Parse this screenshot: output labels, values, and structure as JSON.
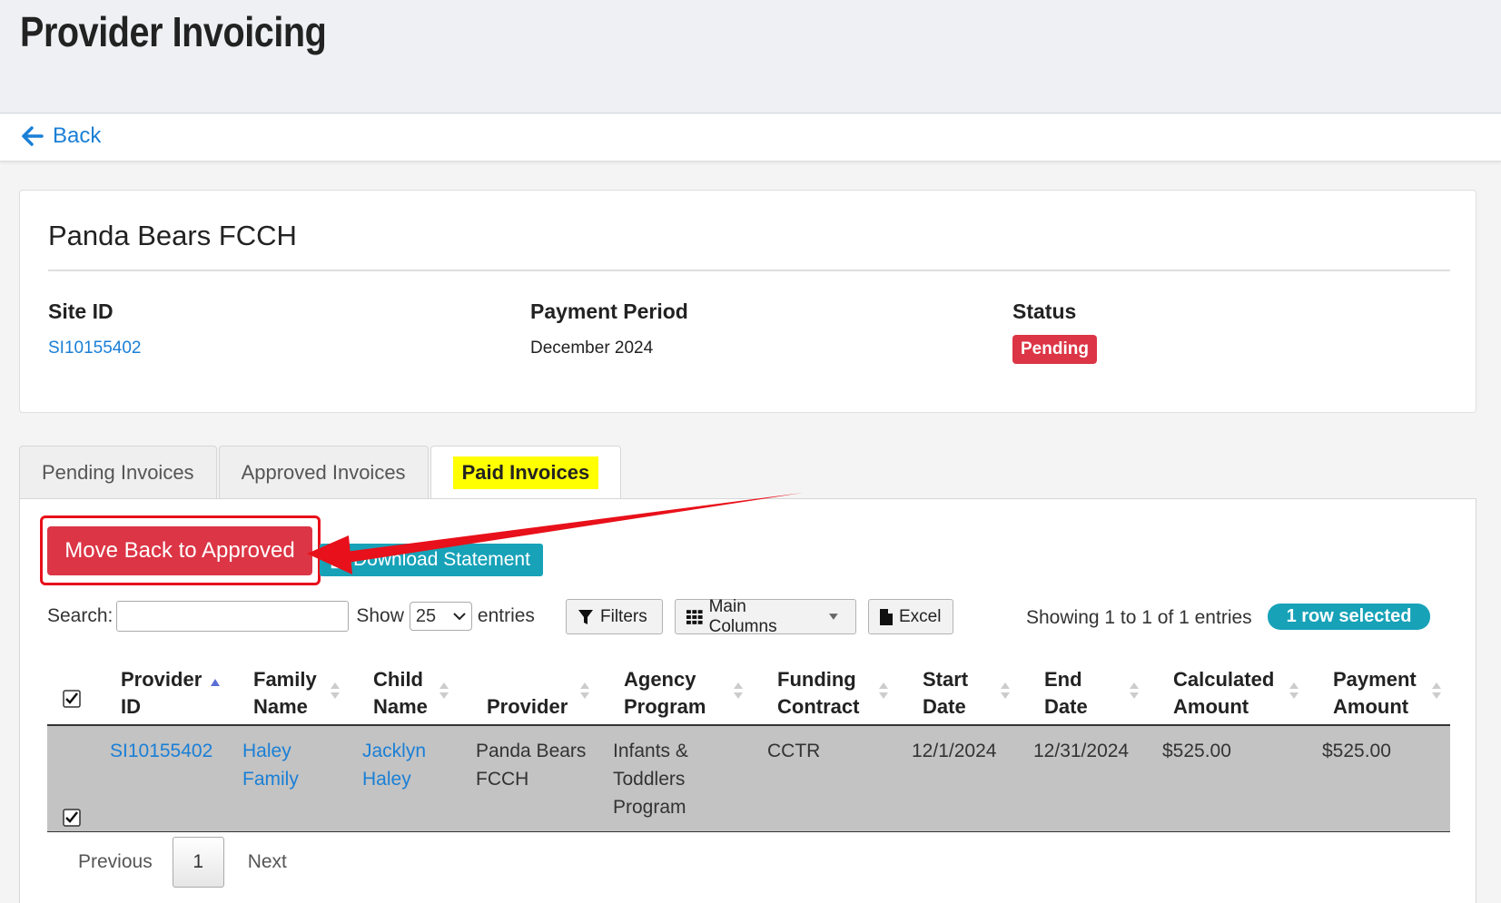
{
  "header": {
    "title": "Provider Invoicing"
  },
  "nav": {
    "back_label": "Back"
  },
  "provider": {
    "name": "Panda Bears FCCH",
    "site_id_label": "Site ID",
    "site_id_value": "SI10155402",
    "period_label": "Payment Period",
    "period_value": "December 2024",
    "status_label": "Status",
    "status_value": "Pending",
    "status_color": "#dc3545"
  },
  "tabs": [
    {
      "label": "Pending Invoices",
      "active": false
    },
    {
      "label": "Approved Invoices",
      "active": false
    },
    {
      "label": "Paid Invoices",
      "active": true
    }
  ],
  "actions": {
    "move_back_label": "Move Back to Approved",
    "download_label": "Download Statement"
  },
  "table_controls": {
    "search_label": "Search:",
    "show_label": "Show",
    "page_size": "25",
    "entries_label": "entries",
    "filters_label": "Filters",
    "columns_label": "Main Columns",
    "excel_label": "Excel",
    "showing_text": "Showing 1 to 1 of 1 entries",
    "selected_badge": "1 row selected"
  },
  "columns": [
    {
      "line1": "Provider",
      "line2": "ID"
    },
    {
      "line1": "Family",
      "line2": "Name"
    },
    {
      "line1": "Child",
      "line2": "Name"
    },
    {
      "line1": "",
      "line2": "Provider"
    },
    {
      "line1": "Agency",
      "line2": "Program"
    },
    {
      "line1": "Funding",
      "line2": "Contract"
    },
    {
      "line1": "Start",
      "line2": "Date"
    },
    {
      "line1": "End",
      "line2": "Date"
    },
    {
      "line1": "Calculated",
      "line2": "Amount"
    },
    {
      "line1": "Payment",
      "line2": "Amount"
    }
  ],
  "rows": [
    {
      "selected": true,
      "provider_id": "SI10155402",
      "family_name_1": "Haley",
      "family_name_2": "Family",
      "child_name_1": "Jacklyn",
      "child_name_2": "Haley",
      "provider_1": "Panda Bears",
      "provider_2": "FCCH",
      "program_1": "Infants &",
      "program_2": "Toddlers",
      "program_3": "Program",
      "contract": "CCTR",
      "start_date": "12/1/2024",
      "end_date": "12/31/2024",
      "calculated_amount": "$525.00",
      "payment_amount": "$525.00"
    }
  ],
  "pagination": {
    "previous_label": "Previous",
    "current_page": "1",
    "next_label": "Next"
  },
  "colors": {
    "accent": "#1a7fd6",
    "danger": "#dc3545",
    "info": "#17a2b8",
    "tab_highlight": "#ffff00",
    "row_selected_bg": "#c3c3c3"
  }
}
